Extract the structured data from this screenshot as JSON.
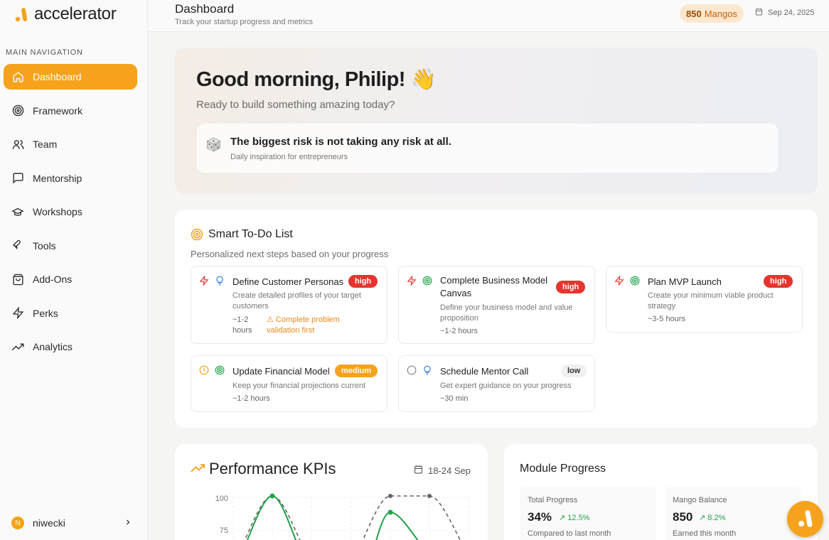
{
  "app": {
    "logo_text": "accelerator"
  },
  "sidebar": {
    "heading": "MAIN NAVIGATION",
    "items": [
      {
        "label": "Dashboard",
        "icon": "home-icon",
        "active": true
      },
      {
        "label": "Framework",
        "icon": "target-icon"
      },
      {
        "label": "Team",
        "icon": "users-icon"
      },
      {
        "label": "Mentorship",
        "icon": "message-square-icon"
      },
      {
        "label": "Workshops",
        "icon": "graduation-cap-icon"
      },
      {
        "label": "Tools",
        "icon": "wrench-icon"
      },
      {
        "label": "Add-Ons",
        "icon": "shopping-bag-icon"
      },
      {
        "label": "Perks",
        "icon": "zap-icon"
      },
      {
        "label": "Analytics",
        "icon": "trending-up-icon"
      }
    ],
    "user": {
      "initial": "N",
      "name": "niwecki"
    }
  },
  "header": {
    "title": "Dashboard",
    "subtitle": "Track your startup progress and metrics",
    "mangos_count": "850",
    "mangos_label": "Mangos",
    "date": "Sep 24, 2025"
  },
  "hero": {
    "greeting": "Good morning, Philip! 👋",
    "subtitle": "Ready to build something amazing today?",
    "quote": "The biggest risk is not taking any risk at all.",
    "quote_caption": "Daily inspiration for entrepreneurs"
  },
  "todo": {
    "title": "Smart To-Do List",
    "subtitle": "Personalized next steps based on your progress",
    "tasks": [
      {
        "title": "Define Customer Personas",
        "priority": "high",
        "description_lines": [
          "Create detailed profiles of your target",
          "customers"
        ],
        "time_lines": [
          "~1-2",
          "hours"
        ],
        "warning_lines": [
          "⚠ Complete problem",
          "validation first"
        ]
      },
      {
        "title_lines": [
          "Complete Business Model",
          "Canvas"
        ],
        "priority": "high",
        "description_lines": [
          "Define your business model and value",
          "proposition"
        ],
        "time": "~1-2 hours"
      },
      {
        "title": "Plan MVP Launch",
        "priority": "high",
        "description_lines": [
          "Create your minimum viable product",
          "strategy"
        ],
        "time": "~3-5 hours"
      },
      {
        "title": "Update Financial Model",
        "priority": "medium",
        "description": "Keep your financial projections current",
        "time": "~1-2 hours"
      },
      {
        "title": "Schedule Mentor Call",
        "priority": "low",
        "description": "Get expert guidance on your progress",
        "time": "~30 min"
      }
    ]
  },
  "kpi": {
    "title": "Performance KPIs",
    "range": "18-24 Sep",
    "y_ticks": [
      "100",
      "75"
    ]
  },
  "module": {
    "title": "Module Progress",
    "stats": [
      {
        "label": "Total Progress",
        "value": "34%",
        "delta": "↗ 12.5%",
        "note": "Compared to last month"
      },
      {
        "label": "Mango Balance",
        "value": "850",
        "delta": "↗ 8.2%",
        "note": "Earned this month"
      }
    ]
  },
  "colors": {
    "accent": "#f6a21c",
    "danger": "#e5342e",
    "success": "#22a34a"
  }
}
